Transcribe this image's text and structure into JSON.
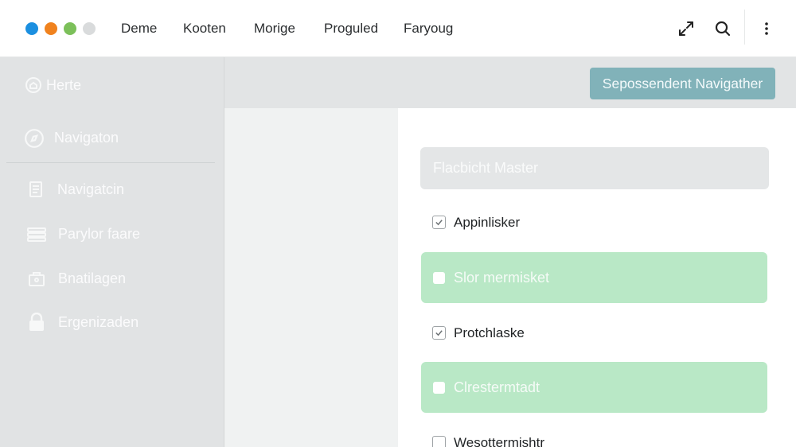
{
  "window": {
    "traffic_colors": [
      "#1b8fe0",
      "#f0821e",
      "#7cc05a",
      "#d9dbdc"
    ]
  },
  "header": {
    "menu": [
      "Deme",
      "Kooten",
      "Morige",
      "Proguled",
      "Faryoug"
    ],
    "actions": [
      "expand-icon",
      "search-icon",
      "more-vertical-icon"
    ]
  },
  "sidebar": {
    "items": [
      {
        "label": "Herte",
        "icon": "home-icon"
      },
      {
        "label": "Navigaton",
        "icon": "compass-icon"
      },
      {
        "label": "Navigatcin",
        "icon": "document-icon"
      },
      {
        "label": "Parylor faare",
        "icon": "layers-icon"
      },
      {
        "label": "Bnatilagen",
        "icon": "briefcase-icon"
      },
      {
        "label": "Ergenizaden",
        "icon": "lock-icon"
      }
    ]
  },
  "main": {
    "primary_button": "Sepossendent Navigather",
    "field_value": "Flacbicht Master",
    "rows": [
      {
        "label": "Appinlisker",
        "checked": true,
        "highlight": false
      },
      {
        "label": "Slor mermisket",
        "checked": false,
        "highlight": true
      },
      {
        "label": "Protchlaske",
        "checked": true,
        "highlight": false
      },
      {
        "label": "Clrestermtadt",
        "checked": false,
        "highlight": true
      },
      {
        "label": "Wesottermishtr",
        "checked": false,
        "highlight": false
      }
    ]
  },
  "colors": {
    "accent_button": "#81b2b9",
    "highlight_row": "#b9e8c6",
    "sidebar_bg": "#e1e3e4"
  }
}
